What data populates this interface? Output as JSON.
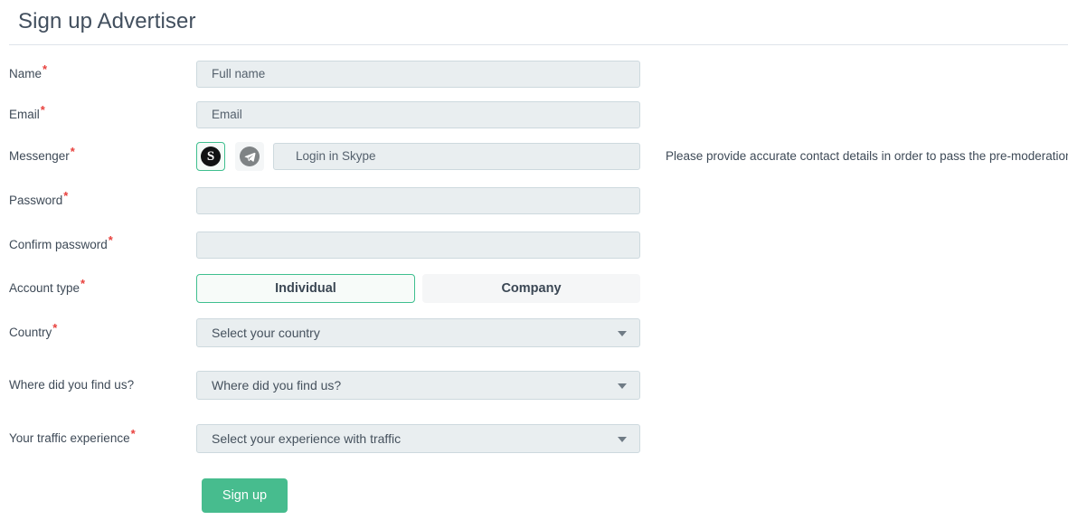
{
  "page": {
    "title": "Sign up Advertiser"
  },
  "hint": {
    "text": "Please provide accurate contact details in order to pass the pre-moderation."
  },
  "required_marker": "*",
  "colors": {
    "accent_green": "#47bc8e",
    "selected_border": "#3fbf8f",
    "required_red": "#e8413d",
    "field_bg": "#e9eef0",
    "field_border": "#cdd9de",
    "text": "#3e4a57"
  },
  "fields": {
    "name": {
      "label": "Name",
      "required": true,
      "placeholder": "Full name",
      "value": ""
    },
    "email": {
      "label": "Email",
      "required": true,
      "placeholder": "Email",
      "value": ""
    },
    "messenger": {
      "label": "Messenger",
      "required": true,
      "placeholder": "Login in Skype",
      "value": "",
      "options": [
        {
          "name": "skype",
          "icon": "skype-icon",
          "glyph": "S",
          "selected": true
        },
        {
          "name": "telegram",
          "icon": "telegram-icon",
          "glyph": "",
          "selected": false
        }
      ]
    },
    "password": {
      "label": "Password",
      "required": true,
      "placeholder": "",
      "value": ""
    },
    "confirm_password": {
      "label": "Confirm password",
      "required": true,
      "placeholder": "",
      "value": ""
    },
    "account_type": {
      "label": "Account type",
      "required": true,
      "options": [
        {
          "label": "Individual",
          "selected": true
        },
        {
          "label": "Company",
          "selected": false
        }
      ]
    },
    "country": {
      "label": "Country",
      "required": true,
      "value": "Select your country"
    },
    "find_us": {
      "label": "Where did you find us?",
      "required": false,
      "value": "Where did you find us?"
    },
    "traffic_experience": {
      "label": "Your traffic experience",
      "required": true,
      "value": "Select your experience with traffic"
    }
  },
  "submit": {
    "label": "Sign up"
  }
}
